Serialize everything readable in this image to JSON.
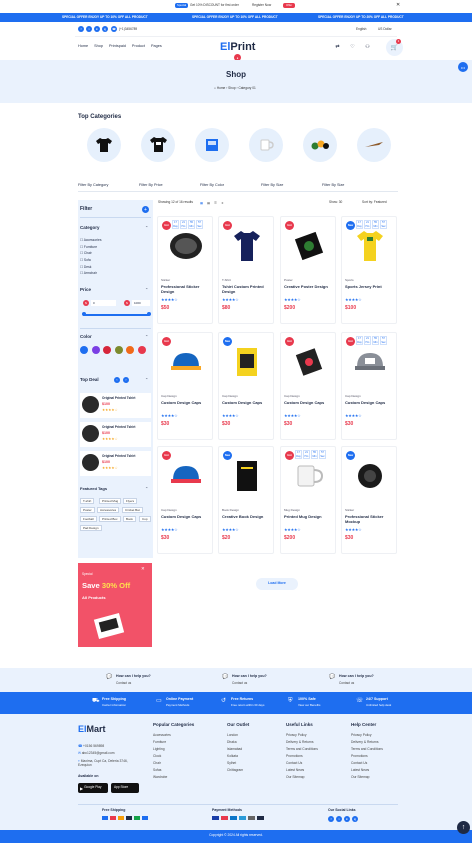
{
  "topbar": {
    "text_left": "SPECIAL OFFER ENJOY UP TO 10% OFF ALL PRODUCT",
    "text_mid": "SPECIAL OFFER ENJOY UP TO 10% OFF ALL PRODUCT",
    "text_right": "SPECIAL OFFER ENJOY UP TO 20% OFF ALL PRODUCT",
    "promo_badge": "Special",
    "promo_text": "Get 10% DISCOUNT for first order",
    "register": "Register Now",
    "offer_btn": "Offer"
  },
  "header": {
    "phone": "(+1)3456789",
    "language": "English",
    "currency": "US Dollar",
    "logo_a": "El",
    "logo_b": "Print",
    "nav": [
      "Home",
      "Shop",
      "Printspaid",
      "Product",
      "Pages"
    ],
    "cart_count": "2"
  },
  "hero": {
    "title": "Shop",
    "crumbs": [
      "Home",
      "Shop",
      "Category 01"
    ]
  },
  "top_categories": {
    "title": "Top Categories"
  },
  "filters": {
    "bar": [
      "Filter By Category",
      "Filter By Price",
      "Filter By Color",
      "Filter By Size",
      "Filter By Size"
    ],
    "showing": "Showing 12 of 16 results",
    "show": "Show: 30",
    "sort": "Sort by: Featured"
  },
  "sidebar": {
    "filter_title": "Filter",
    "category_title": "Category",
    "categories": [
      "Accessories",
      "Furniture",
      "Chair",
      "Sofa",
      "Desk",
      "Armchair"
    ],
    "price_title": "Price",
    "price_min": "0",
    "price_max": "1000",
    "price_cur": "$",
    "color_title": "Color",
    "colors": [
      "#1e6ef0",
      "#7b3fe4",
      "#d6263b",
      "#7c8b2e",
      "#f06a1a",
      "#e8394d"
    ],
    "topdeal_title": "Top Deal",
    "deals": [
      {
        "name": "Original Printed Tshirt",
        "price": "$100"
      },
      {
        "name": "Original Printed Tshirt",
        "price": "$100"
      },
      {
        "name": "Original Printed Tshirt",
        "price": "$100"
      }
    ],
    "tags_title": "Featured Tags",
    "tags": [
      "T-shirt",
      "Printed Mug",
      "Flyers",
      "Poster",
      "Accessories",
      "Cricket Bat",
      "Football",
      "Printed Box",
      "Book",
      "Cup",
      "Pad Design"
    ],
    "promo_label": "Special",
    "promo_save": "Save ",
    "promo_pct": "30% Off",
    "promo_all": "All Products"
  },
  "products": [
    {
      "badge": "Hot",
      "cat": "Sticker",
      "name": "Professional Sticker Design",
      "price": "$50",
      "countdown": true
    },
    {
      "badge": "Hot",
      "cat": "T-Shirt",
      "name": "Tshirt Custom Printed Design",
      "price": "$80",
      "countdown": false
    },
    {
      "badge": "Hot",
      "cat": "Poster",
      "name": "Creative Poster Design",
      "price": "$200",
      "countdown": false
    },
    {
      "badge": "New",
      "cat": "Sports",
      "name": "Sports Jersey Print",
      "price": "$100",
      "countdown": true
    },
    {
      "badge": "Hot",
      "cat": "Cap Design",
      "name": "Custom Design Caps",
      "price": "$30",
      "countdown": false
    },
    {
      "badge": "New",
      "cat": "Cap Design",
      "name": "Custom Design Caps",
      "price": "$30",
      "countdown": false
    },
    {
      "badge": "Hot",
      "cat": "Cap Design",
      "name": "Custom Design Caps",
      "price": "$30",
      "countdown": false
    },
    {
      "badge": "Hot",
      "cat": "Cap Design",
      "name": "Custom Design Caps",
      "price": "$30",
      "countdown": true
    },
    {
      "badge": "Hot",
      "cat": "Cap Design",
      "name": "Custom Design Caps",
      "price": "$30",
      "countdown": false
    },
    {
      "badge": "New",
      "cat": "Book Design",
      "name": "Creative Book Design",
      "price": "$20",
      "countdown": false
    },
    {
      "badge": "Hot",
      "cat": "Mug Design",
      "name": "Printed Mug Design",
      "price": "$200",
      "countdown": true
    },
    {
      "badge": "New",
      "cat": "Sticker",
      "name": "Professional Sticker Mockup",
      "price": "$30",
      "countdown": false
    }
  ],
  "countdown_labels": [
    "17",
    "21",
    "55",
    "57"
  ],
  "countdown_units": [
    "Day",
    "Hrs",
    "Min",
    "Sec"
  ],
  "load_more": "Load More",
  "help": [
    {
      "title": "How can I help you?",
      "sub": "Contact us"
    },
    {
      "title": "How can I help you?",
      "sub": "Contact us"
    },
    {
      "title": "How can I help you?",
      "sub": "Contact us"
    }
  ],
  "features": [
    {
      "title": "Free Shipping",
      "sub": "Carrier information"
    },
    {
      "title": "Online Payment",
      "sub": "Payment Methods"
    },
    {
      "title": "Free Returns",
      "sub": "Free return within 30 days"
    },
    {
      "title": "100% Safe",
      "sub": "View our Benefits"
    },
    {
      "title": "24/7 Support",
      "sub": "Unlimited help desk"
    }
  ],
  "footer": {
    "logo_a": "El",
    "logo_b": "Mart",
    "phone": "+0156 569898",
    "email": "abc12345@gmail.com",
    "address": "Maxima, Cupt Ca, Deleria 3746, Ezequiun",
    "available": "Available on",
    "gplay": "Google Play",
    "appstore": "App Store",
    "cols": [
      {
        "title": "Popular Categories",
        "items": [
          "Accessories",
          "Furniture",
          "Lighting",
          "Clock",
          "Chair",
          "Sofas",
          "Wardrobe"
        ]
      },
      {
        "title": "Our Outlet",
        "items": [
          "London",
          "Dhaka",
          "Islamabad",
          "Kolkata",
          "Sylhet",
          "Chittagram"
        ]
      },
      {
        "title": "Useful Links",
        "items": [
          "Privacy Policy",
          "Delivery & Returns",
          "Terms and Conditions",
          "Promotions",
          "Contact Us",
          "Latest News",
          "Our Sitemap"
        ]
      },
      {
        "title": "Help Center",
        "items": [
          "Privacy Policy",
          "Delivery & Returns",
          "Terms and Conditions",
          "Promotions",
          "Contact Us",
          "Latest News",
          "Our Sitemap"
        ]
      }
    ],
    "free_shipping": "Free Shipping",
    "payment_methods": "Payment Methods",
    "social": "Our Social Links",
    "copyright": "Copyright © 2024 All rights reserved."
  }
}
